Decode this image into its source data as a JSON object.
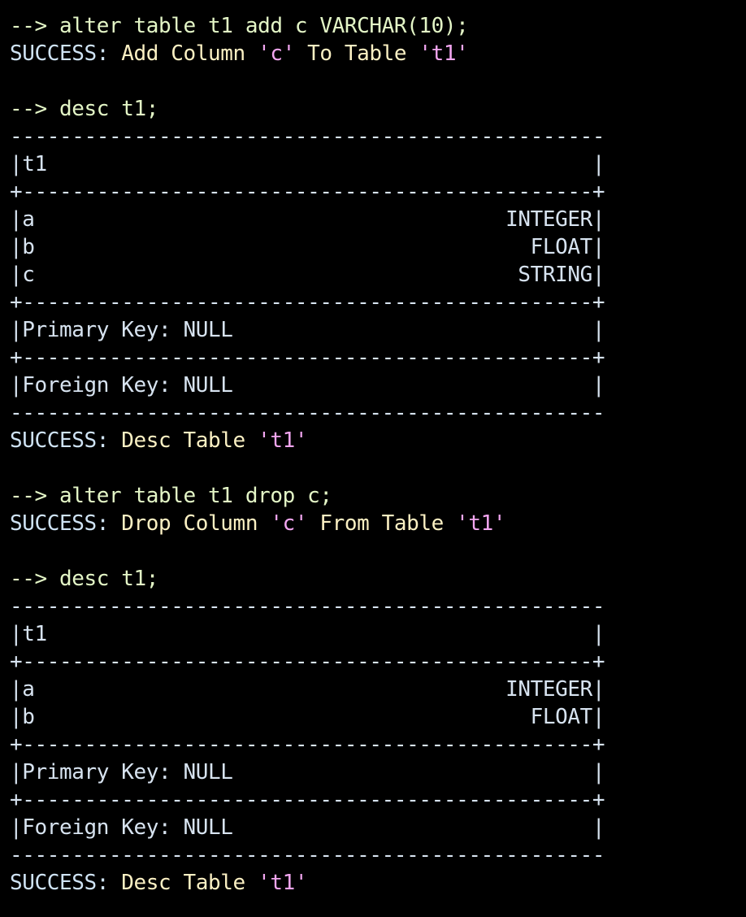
{
  "colors": {
    "background": "#000000",
    "command": "#e3f5c6",
    "success": "#cfe3f4",
    "message": "#fbf0c3",
    "quoted": "#f2a6f0",
    "table": "#d7e3f0"
  },
  "terminal": {
    "lines": [
      {
        "kind": "command",
        "segments": [
          {
            "style": "command",
            "text": "--> alter table t1 add c VARCHAR(10);"
          }
        ]
      },
      {
        "kind": "output",
        "segments": [
          {
            "style": "success",
            "text": "SUCCESS: "
          },
          {
            "style": "message",
            "text": "Add Column "
          },
          {
            "style": "quoted",
            "text": "'c'"
          },
          {
            "style": "message",
            "text": " To Table "
          },
          {
            "style": "quoted",
            "text": "'t1'"
          }
        ]
      },
      {
        "kind": "blank",
        "segments": []
      },
      {
        "kind": "command",
        "segments": [
          {
            "style": "command",
            "text": "--> desc t1;"
          }
        ]
      },
      {
        "kind": "table",
        "segments": [
          {
            "style": "table",
            "text": "------------------------------------------------"
          }
        ]
      },
      {
        "kind": "table",
        "segments": [
          {
            "style": "table",
            "text": "|t1                                            |"
          }
        ]
      },
      {
        "kind": "table",
        "segments": [
          {
            "style": "table",
            "text": "+----------------------------------------------+"
          }
        ]
      },
      {
        "kind": "table",
        "segments": [
          {
            "style": "table",
            "text": "|a                                      INTEGER|"
          }
        ]
      },
      {
        "kind": "table",
        "segments": [
          {
            "style": "table",
            "text": "|b                                        FLOAT|"
          }
        ]
      },
      {
        "kind": "table",
        "segments": [
          {
            "style": "table",
            "text": "|c                                       STRING|"
          }
        ]
      },
      {
        "kind": "table",
        "segments": [
          {
            "style": "table",
            "text": "+----------------------------------------------+"
          }
        ]
      },
      {
        "kind": "table",
        "segments": [
          {
            "style": "table",
            "text": "|Primary Key: NULL                             |"
          }
        ]
      },
      {
        "kind": "table",
        "segments": [
          {
            "style": "table",
            "text": "+----------------------------------------------+"
          }
        ]
      },
      {
        "kind": "table",
        "segments": [
          {
            "style": "table",
            "text": "|Foreign Key: NULL                             |"
          }
        ]
      },
      {
        "kind": "table",
        "segments": [
          {
            "style": "table",
            "text": "------------------------------------------------"
          }
        ]
      },
      {
        "kind": "output",
        "segments": [
          {
            "style": "success",
            "text": "SUCCESS: "
          },
          {
            "style": "message",
            "text": "Desc Table "
          },
          {
            "style": "quoted",
            "text": "'t1'"
          }
        ]
      },
      {
        "kind": "blank",
        "segments": []
      },
      {
        "kind": "command",
        "segments": [
          {
            "style": "command",
            "text": "--> alter table t1 drop c;"
          }
        ]
      },
      {
        "kind": "output",
        "segments": [
          {
            "style": "success",
            "text": "SUCCESS: "
          },
          {
            "style": "message",
            "text": "Drop Column "
          },
          {
            "style": "quoted",
            "text": "'c'"
          },
          {
            "style": "message",
            "text": " From Table "
          },
          {
            "style": "quoted",
            "text": "'t1'"
          }
        ]
      },
      {
        "kind": "blank",
        "segments": []
      },
      {
        "kind": "command",
        "segments": [
          {
            "style": "command",
            "text": "--> desc t1;"
          }
        ]
      },
      {
        "kind": "table",
        "segments": [
          {
            "style": "table",
            "text": "------------------------------------------------"
          }
        ]
      },
      {
        "kind": "table",
        "segments": [
          {
            "style": "table",
            "text": "|t1                                            |"
          }
        ]
      },
      {
        "kind": "table",
        "segments": [
          {
            "style": "table",
            "text": "+----------------------------------------------+"
          }
        ]
      },
      {
        "kind": "table",
        "segments": [
          {
            "style": "table",
            "text": "|a                                      INTEGER|"
          }
        ]
      },
      {
        "kind": "table",
        "segments": [
          {
            "style": "table",
            "text": "|b                                        FLOAT|"
          }
        ]
      },
      {
        "kind": "table",
        "segments": [
          {
            "style": "table",
            "text": "+----------------------------------------------+"
          }
        ]
      },
      {
        "kind": "table",
        "segments": [
          {
            "style": "table",
            "text": "|Primary Key: NULL                             |"
          }
        ]
      },
      {
        "kind": "table",
        "segments": [
          {
            "style": "table",
            "text": "+----------------------------------------------+"
          }
        ]
      },
      {
        "kind": "table",
        "segments": [
          {
            "style": "table",
            "text": "|Foreign Key: NULL                             |"
          }
        ]
      },
      {
        "kind": "table",
        "segments": [
          {
            "style": "table",
            "text": "------------------------------------------------"
          }
        ]
      },
      {
        "kind": "output",
        "segments": [
          {
            "style": "success",
            "text": "SUCCESS: "
          },
          {
            "style": "message",
            "text": "Desc Table "
          },
          {
            "style": "quoted",
            "text": "'t1'"
          }
        ]
      }
    ]
  }
}
